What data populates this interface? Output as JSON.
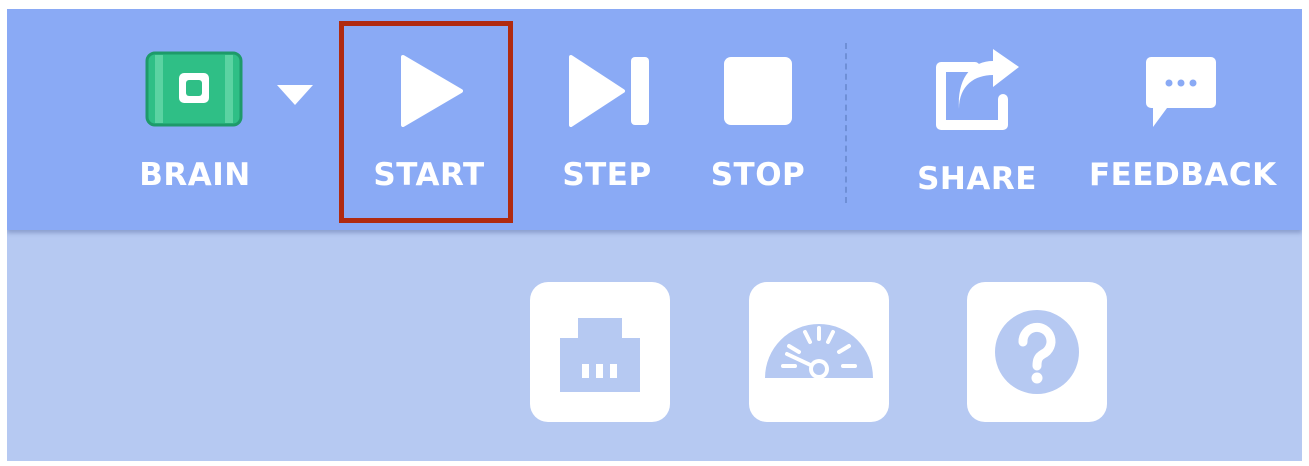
{
  "toolbar": {
    "brain": {
      "label": "BRAIN",
      "icon": "brain-icon",
      "icon_color": "#2fbf86"
    },
    "start": {
      "label": "START",
      "icon": "play-icon"
    },
    "step": {
      "label": "STEP",
      "icon": "step-icon"
    },
    "stop": {
      "label": "STOP",
      "icon": "stop-icon"
    },
    "share": {
      "label": "SHARE",
      "icon": "share-icon"
    },
    "feedback": {
      "label": "FEEDBACK",
      "icon": "feedback-icon"
    },
    "highlighted_button": "start"
  },
  "tiles": [
    {
      "name": "ethernet-port-tile",
      "icon": "ethernet-port-icon"
    },
    {
      "name": "gauge-tile",
      "icon": "gauge-icon"
    },
    {
      "name": "help-tile",
      "icon": "help-icon"
    }
  ],
  "colors": {
    "toolbar_bg": "#8aaaf5",
    "workspace_bg": "#b6c9f2",
    "icon_white": "#ffffff",
    "highlight_border": "#b02a10"
  }
}
